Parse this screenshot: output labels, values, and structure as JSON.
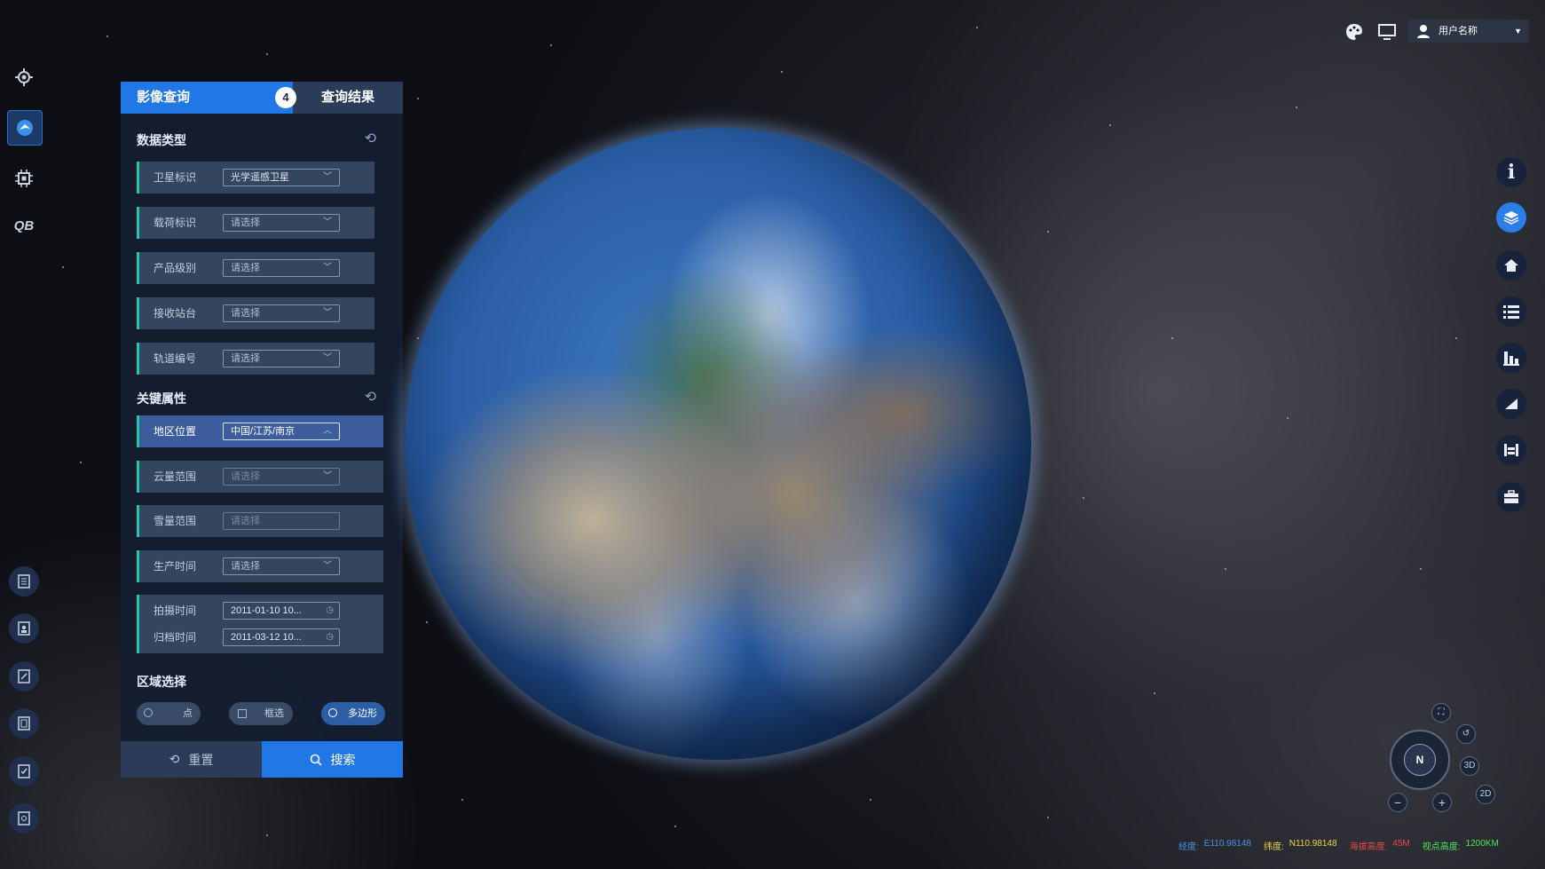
{
  "user": {
    "name": "用户名称"
  },
  "panel": {
    "tabs": {
      "active": "影像查询",
      "other": "查询结果",
      "badge": "4"
    },
    "data_type": {
      "title": "数据类型",
      "rows": [
        {
          "label": "卫星标识",
          "value": "光学遥感卫星"
        },
        {
          "label": "载荷标识",
          "value": "请选择"
        },
        {
          "label": "产品级别",
          "value": "请选择"
        },
        {
          "label": "接收站台",
          "value": "请选择"
        },
        {
          "label": "轨道编号",
          "value": "请选择"
        }
      ]
    },
    "key_attrs": {
      "title": "关键属性",
      "rows": [
        {
          "label": "地区位置",
          "value": "中国/江苏/南京"
        },
        {
          "label": "云量范围",
          "value": "请选择"
        },
        {
          "label": "雪量范围",
          "value": "请选择"
        },
        {
          "label": "生产时间",
          "value": "请选择"
        }
      ],
      "shoot_time": {
        "label": "拍摄时间",
        "value": "2011-01-10  10..."
      },
      "archive_time": {
        "label": "归档时间",
        "value": "2011-03-12  10..."
      }
    },
    "region": {
      "title": "区域选择",
      "options": [
        {
          "label": "点",
          "selected": false
        },
        {
          "label": "框选",
          "selected": false
        },
        {
          "label": "多边形",
          "selected": true
        }
      ]
    },
    "buttons": {
      "reset": "重置",
      "search": "搜索"
    }
  },
  "map_controls": {
    "north": "N",
    "mode_3d": "3D",
    "mode_2d": "2D"
  },
  "status_bar": {
    "lon_label": "经度:",
    "lon": "E110.98148",
    "lat_label": "纬度:",
    "lat": "N110.98148",
    "alt_label": "海拔高度:",
    "alt": "45M",
    "view_label": "视点高度:",
    "view": "1200KM",
    "colors": {
      "lon": "#4a8fe8",
      "lat": "#e8d84a",
      "alt": "#e84a4a",
      "view": "#4ae85a"
    }
  },
  "left_bar_label": "QB"
}
